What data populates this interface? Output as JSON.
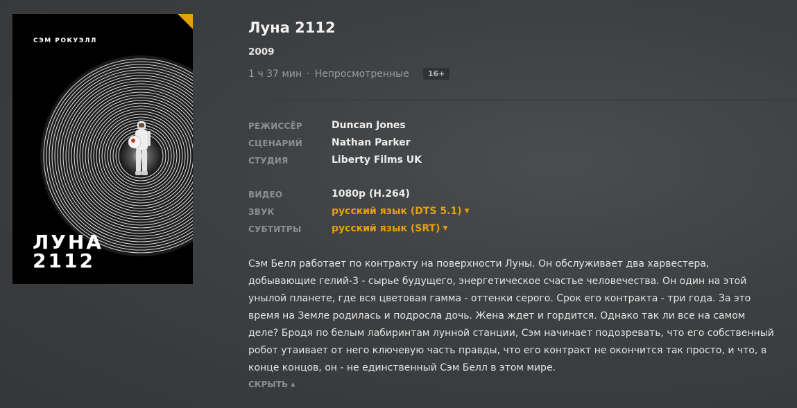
{
  "poster": {
    "actor_credit": "СЭМ РОКУЭЛЛ",
    "title_line1": "ЛУНА",
    "title_line2": "2112",
    "corner_color": "#e5a00d"
  },
  "movie": {
    "title": "Луна 2112",
    "year": "2009",
    "duration": "1 ч 37 мин",
    "separator": "·",
    "watch_status": "Непросмотренные",
    "content_rating": "16+"
  },
  "credits": [
    {
      "label": "РЕЖИССЁР",
      "value": "Duncan Jones"
    },
    {
      "label": "СЦЕНАРИЙ",
      "value": "Nathan Parker"
    },
    {
      "label": "СТУДИЯ",
      "value": "Liberty Films UK"
    }
  ],
  "media": {
    "video": {
      "label": "ВИДЕО",
      "value": "1080p (H.264)"
    },
    "audio": {
      "label": "ЗВУК",
      "value": "русский язык (DTS 5.1)",
      "caret_icon": "caret-down-icon"
    },
    "subtitles": {
      "label": "СУБТИТРЫ",
      "value": "русский язык (SRT)",
      "caret_icon": "caret-down-icon"
    }
  },
  "summary": {
    "text": "Сэм Белл работает по контракту на поверхности Луны. Он обслуживает два харвестера, добывающие гелий-3 - сырье будущего, энергетическое счастье человечества. Он один на этой унылой планете, где вся цветовая гамма - оттенки серого. Срок его контракта - три года. За это время на Земле родилась и подросла дочь. Жена ждет и гордится. Однако так ли все на самом деле? Бродя по белым лабиринтам лунной станции, Сэм начинает подозревать, что его собственный робот утаивает от него ключевую часть правды, что его контракт не окончится так просто, и что, в конце концов, он - не единственный Сэм Белл в этом мире.",
    "collapse_label": "СКРЫТЬ",
    "collapse_icon": "caret-up-icon"
  },
  "colors": {
    "accent": "#e5a00d",
    "background": "#3d3f41",
    "label": "#8d8e90"
  }
}
